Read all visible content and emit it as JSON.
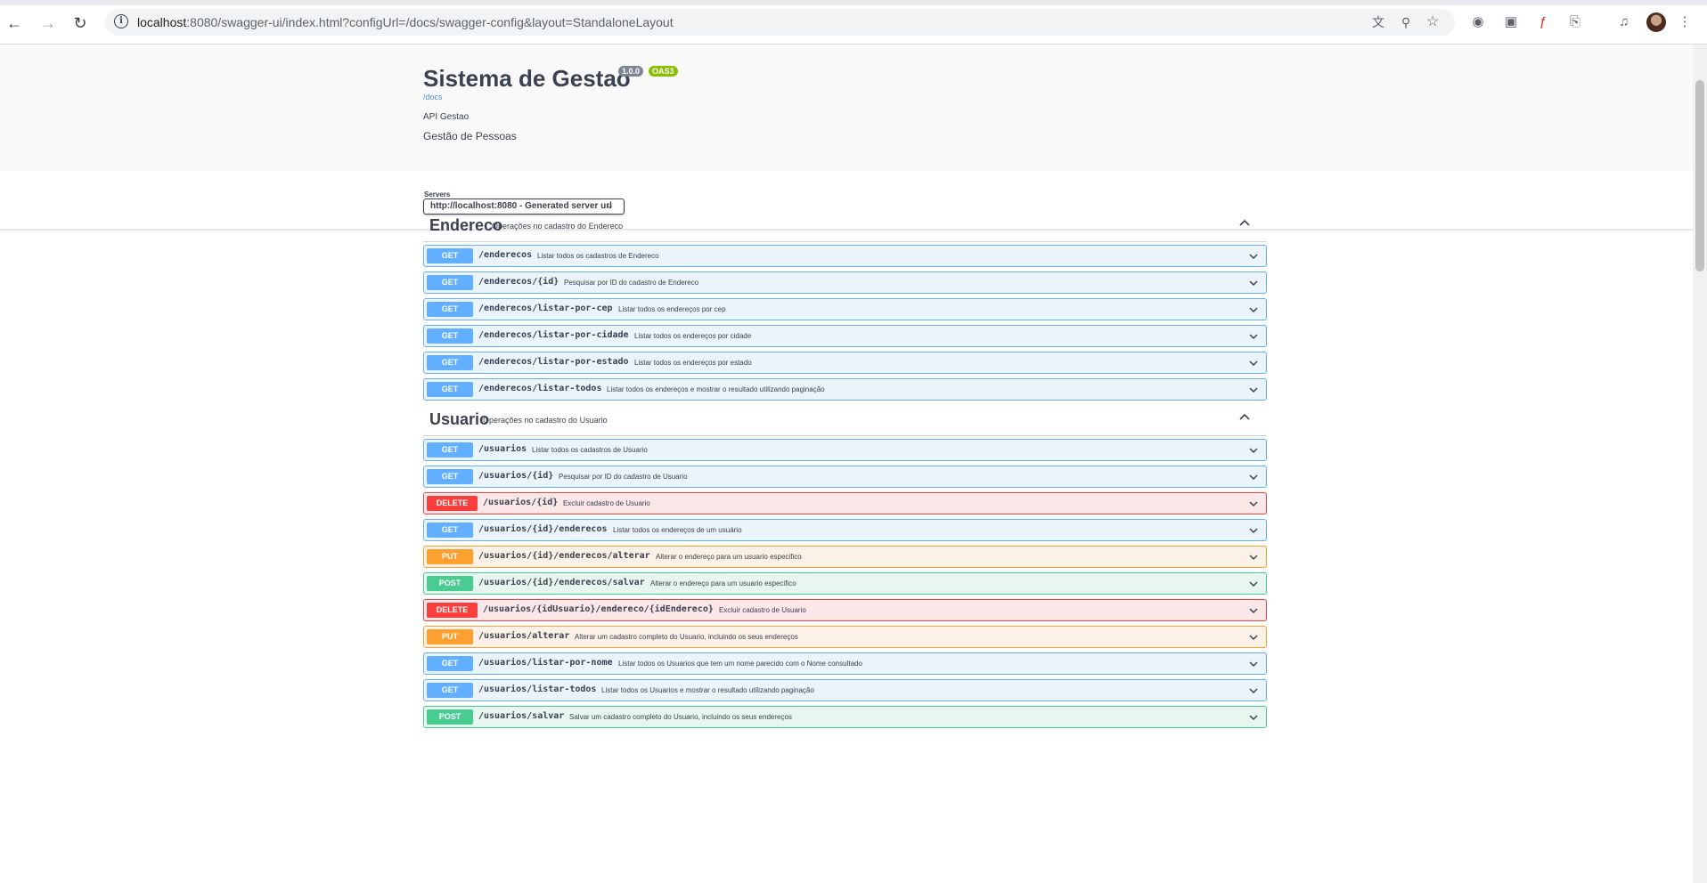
{
  "browser": {
    "url_main": "localhost",
    "url_rest": ":8080/swagger-ui/index.html?configUrl=/docs/swagger-config&layout=StandaloneLayout"
  },
  "info": {
    "title": "Sistema de Gestao",
    "version": "1.0.0",
    "oas": "OAS3",
    "docs_link": "/docs",
    "description_1": "API Gestao",
    "description_2": "Gestão de Pessoas"
  },
  "servers": {
    "label": "Servers",
    "selected": "http://localhost:8080 - Generated server url"
  },
  "tags": [
    {
      "name": "Endereco",
      "description": "Operações no cadastro do Endereco",
      "operations": [
        {
          "method": "GET",
          "path": "/enderecos",
          "summary": "Listar todos os cadastros de Endereco"
        },
        {
          "method": "GET",
          "path": "/enderecos/{id}",
          "summary": "Pesquisar por ID do cadastro de Endereco"
        },
        {
          "method": "GET",
          "path": "/enderecos/listar-por-cep",
          "summary": "Listar todos os endereços por cep"
        },
        {
          "method": "GET",
          "path": "/enderecos/listar-por-cidade",
          "summary": "Listar todos os endereços por cidade"
        },
        {
          "method": "GET",
          "path": "/enderecos/listar-por-estado",
          "summary": "Listar todos os endereços por estado"
        },
        {
          "method": "GET",
          "path": "/enderecos/listar-todos",
          "summary": "Listar todos os endereços e mostrar o resultado utilizando paginação"
        }
      ]
    },
    {
      "name": "Usuario",
      "description": "Operações no cadastro do Usuario",
      "operations": [
        {
          "method": "GET",
          "path": "/usuarios",
          "summary": "Listar todos os cadastros de Usuario"
        },
        {
          "method": "GET",
          "path": "/usuarios/{id}",
          "summary": "Pesquisar por ID do cadastro de Usuario"
        },
        {
          "method": "DELETE",
          "path": "/usuarios/{id}",
          "summary": "Excluir cadastro de Usuario"
        },
        {
          "method": "GET",
          "path": "/usuarios/{id}/enderecos",
          "summary": "Listar todos os endereços de um usuário"
        },
        {
          "method": "PUT",
          "path": "/usuarios/{id}/enderecos/alterar",
          "summary": "Alterar o endereço para um usuario especifico"
        },
        {
          "method": "POST",
          "path": "/usuarios/{id}/enderecos/salvar",
          "summary": "Alterar o endereço para um usuario especifico"
        },
        {
          "method": "DELETE",
          "path": "/usuarios/{idUsuario}/endereco/{idEndereco}",
          "summary": "Excluir cadastro de Usuario"
        },
        {
          "method": "PUT",
          "path": "/usuarios/alterar",
          "summary": "Alterar um cadastro completo do Usuario, incluindo os seus endereços"
        },
        {
          "method": "GET",
          "path": "/usuarios/listar-por-nome",
          "summary": "Listar todos os Usuarios que tem um nome parecido com o Nome consultado"
        },
        {
          "method": "GET",
          "path": "/usuarios/listar-todos",
          "summary": "Listar todos os Usuarios e mostrar o resultado utilizando paginação"
        },
        {
          "method": "POST",
          "path": "/usuarios/salvar",
          "summary": "Salvar um cadastro completo do Usuario, incluindo os seus endereços"
        }
      ]
    }
  ]
}
